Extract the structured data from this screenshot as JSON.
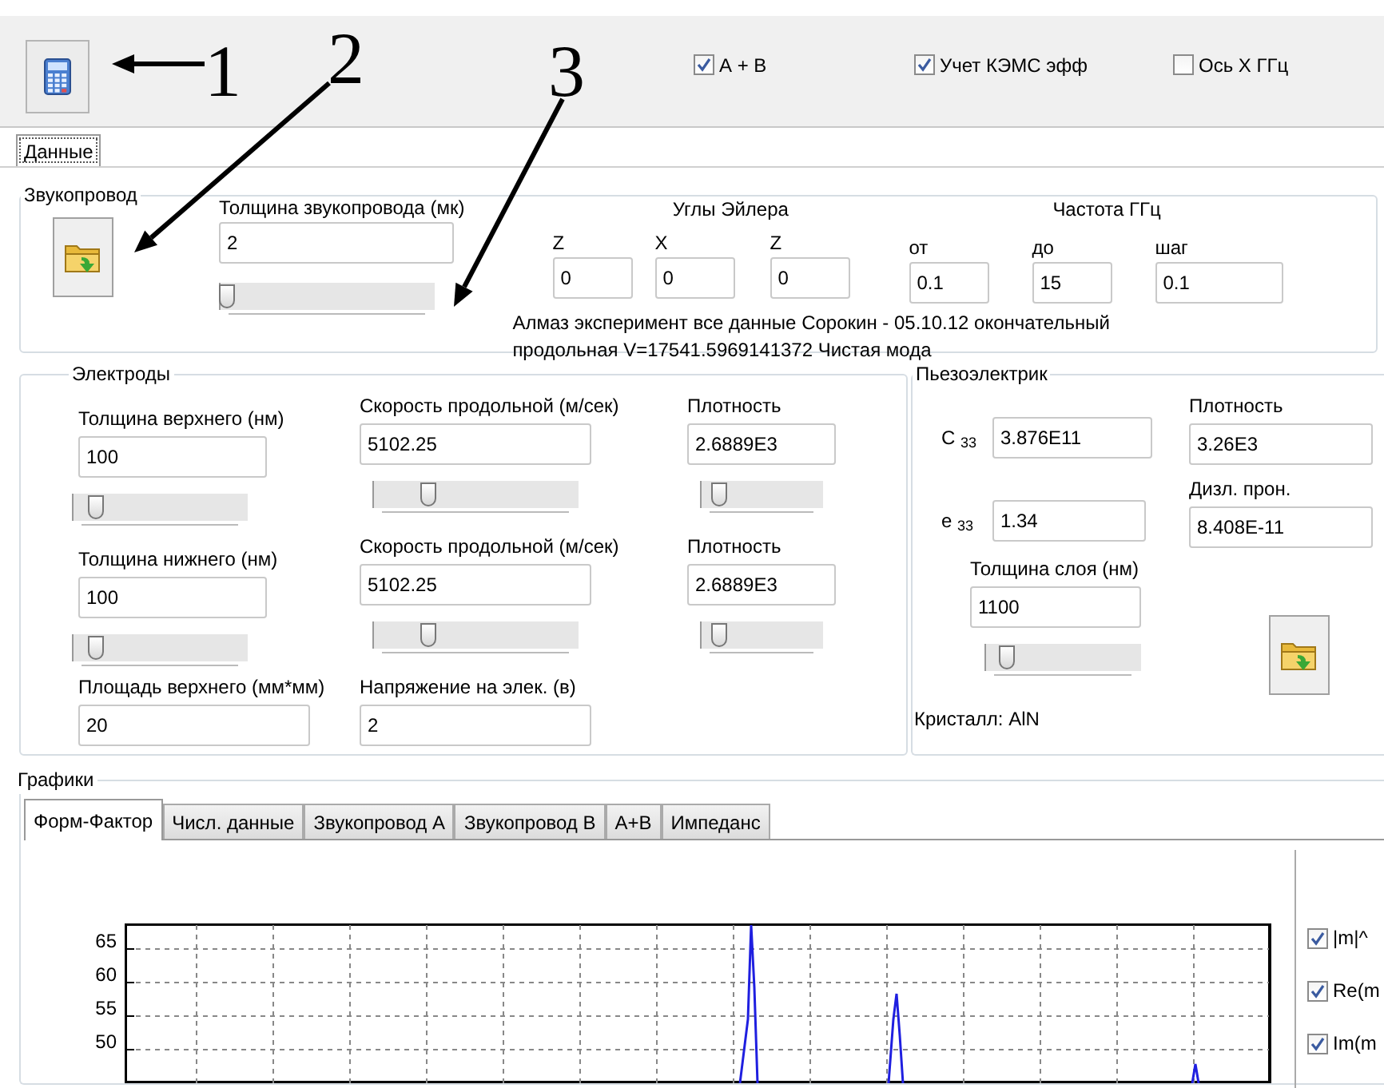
{
  "toolbar": {
    "checkboxes": [
      {
        "label": "А + В",
        "checked": true
      },
      {
        "label": "Учет КЭМС эфф",
        "checked": true
      },
      {
        "label": "Ось X ГГц",
        "checked": false
      }
    ]
  },
  "annotations": [
    {
      "label": "1"
    },
    {
      "label": "2"
    },
    {
      "label": "3"
    }
  ],
  "main_tabs": [
    {
      "label": "Данные",
      "selected": true
    }
  ],
  "waveguide": {
    "title": "Звукопровод",
    "thickness": {
      "label": "Толщина звукопровода (мк)",
      "value": "2",
      "level": 0.0
    },
    "euler": {
      "title": "Углы Эйлера",
      "fields": [
        {
          "label": "Z",
          "value": "0"
        },
        {
          "label": "X",
          "value": "0"
        },
        {
          "label": "Z",
          "value": "0"
        }
      ]
    },
    "frequency": {
      "title": "Частота ГГц",
      "fields": [
        {
          "label": "от",
          "value": "0.1"
        },
        {
          "label": "до",
          "value": "15"
        },
        {
          "label": "шаг",
          "value": "0.1"
        }
      ]
    },
    "description": [
      "Алмаз эксперимент все данные Сорокин - 05.10.12 окончательный",
      "продольная V=17541.5969141372 Чистая мода"
    ]
  },
  "electrodes": {
    "title": "Электроды",
    "rows": [
      [
        {
          "label": "Толщина верхнего (нм)",
          "value": "100",
          "level": 0.1
        },
        {
          "label": "Скорость продольной (м/сек)",
          "value": "5102.25",
          "level": 0.25
        },
        {
          "label": "Плотность",
          "value": "2.6889E3",
          "level": 0.1
        }
      ],
      [
        {
          "label": "Толщина нижнего (нм)",
          "value": "100",
          "level": 0.1
        },
        {
          "label": "Скорость продольной (м/сек)",
          "value": "5102.25",
          "level": 0.25
        },
        {
          "label": "Плотность",
          "value": "2.6889E3",
          "level": 0.1
        }
      ],
      [
        {
          "label": "Площадь верхнего (мм*мм)",
          "value": "20"
        },
        {
          "label": "Напряжение на элек. (в)",
          "value": "2"
        }
      ]
    ]
  },
  "piezo": {
    "title": "Пьезоэлектрик",
    "c33": {
      "label": "C $_{33}$",
      "value": "3.876E11"
    },
    "density": {
      "label": "Плотность",
      "value": "3.26E3"
    },
    "e33": {
      "label": "e $_{33}$",
      "value": "1.34"
    },
    "dielectric": {
      "label": "Дизл. прон.",
      "value": "8.408E-11"
    },
    "layer": {
      "label": "Толщина слоя (нм)",
      "value": "1100",
      "level": 0.1
    },
    "crystal": "Кристалл: AlN"
  },
  "graphs": {
    "title": "Графики",
    "tabs": [
      {
        "label": "Форм-Фактор",
        "selected": true
      },
      {
        "label": "Числ. данные",
        "selected": false
      },
      {
        "label": "Звукопровод А",
        "selected": false
      },
      {
        "label": "Звукопровод В",
        "selected": false
      },
      {
        "label": "А+В",
        "selected": false
      },
      {
        "label": "Импеданс",
        "selected": false
      }
    ],
    "y_ticks": [
      "65",
      "60",
      "55",
      "50"
    ],
    "series_toggles": [
      {
        "label": "|m|^",
        "checked": true
      },
      {
        "label": "Re(m",
        "checked": true
      },
      {
        "label": "Im(m",
        "checked": true
      }
    ]
  }
}
